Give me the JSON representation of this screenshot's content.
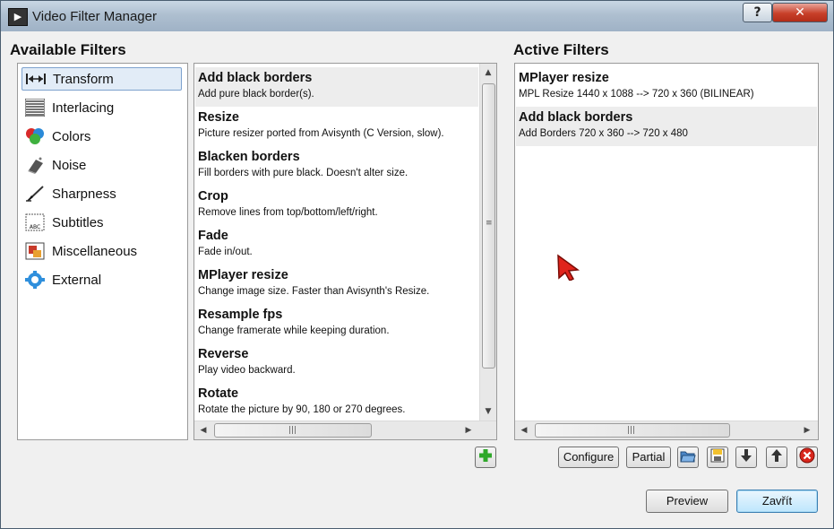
{
  "window": {
    "title": "Video Filter Manager",
    "help_label": "?",
    "close_label": "✕"
  },
  "available": {
    "title": "Available Filters",
    "categories": [
      {
        "label": "Transform",
        "icon": "transform-icon",
        "selected": true
      },
      {
        "label": "Interlacing",
        "icon": "interlacing-icon"
      },
      {
        "label": "Colors",
        "icon": "colors-icon"
      },
      {
        "label": "Noise",
        "icon": "noise-icon"
      },
      {
        "label": "Sharpness",
        "icon": "sharpness-icon"
      },
      {
        "label": "Subtitles",
        "icon": "subtitles-icon"
      },
      {
        "label": "Miscellaneous",
        "icon": "miscellaneous-icon"
      },
      {
        "label": "External",
        "icon": "external-icon"
      }
    ],
    "filters": [
      {
        "name": "Add black borders",
        "desc": "Add pure black border(s)."
      },
      {
        "name": "Resize",
        "desc": "Picture resizer ported from Avisynth (C Version, slow)."
      },
      {
        "name": "Blacken borders",
        "desc": "Fill borders with pure black. Doesn't alter size."
      },
      {
        "name": "Crop",
        "desc": "Remove lines from top/bottom/left/right."
      },
      {
        "name": "Fade",
        "desc": "Fade in/out."
      },
      {
        "name": "MPlayer resize",
        "desc": "Change image size. Faster than Avisynth's Resize."
      },
      {
        "name": "Resample fps",
        "desc": "Change framerate while keeping duration."
      },
      {
        "name": "Reverse",
        "desc": "Play video backward."
      },
      {
        "name": "Rotate",
        "desc": "Rotate the picture by 90, 180 or 270 degrees."
      }
    ],
    "add_icon": "plus-icon"
  },
  "active": {
    "title": "Active Filters",
    "filters": [
      {
        "name": "MPlayer resize",
        "desc": "MPL Resize 1440 x 1088 --> 720 x 360 (BILINEAR)"
      },
      {
        "name": "Add black borders",
        "desc": "Add Borders 720 x 360 --> 720 x 480"
      }
    ]
  },
  "toolbar": {
    "configure_label": "Configure",
    "partial_label": "Partial",
    "icons": [
      "open-icon",
      "save-icon",
      "move-down-icon",
      "move-up-icon",
      "remove-icon"
    ]
  },
  "footer": {
    "preview_label": "Preview",
    "close_label": "Zavřít"
  },
  "colors": {
    "selection_bg": "#e2ecf7",
    "selection_border": "#7da2ce",
    "add_green": "#2fa82a",
    "remove_red": "#d8261c",
    "cursor_red": "#e0241c"
  }
}
